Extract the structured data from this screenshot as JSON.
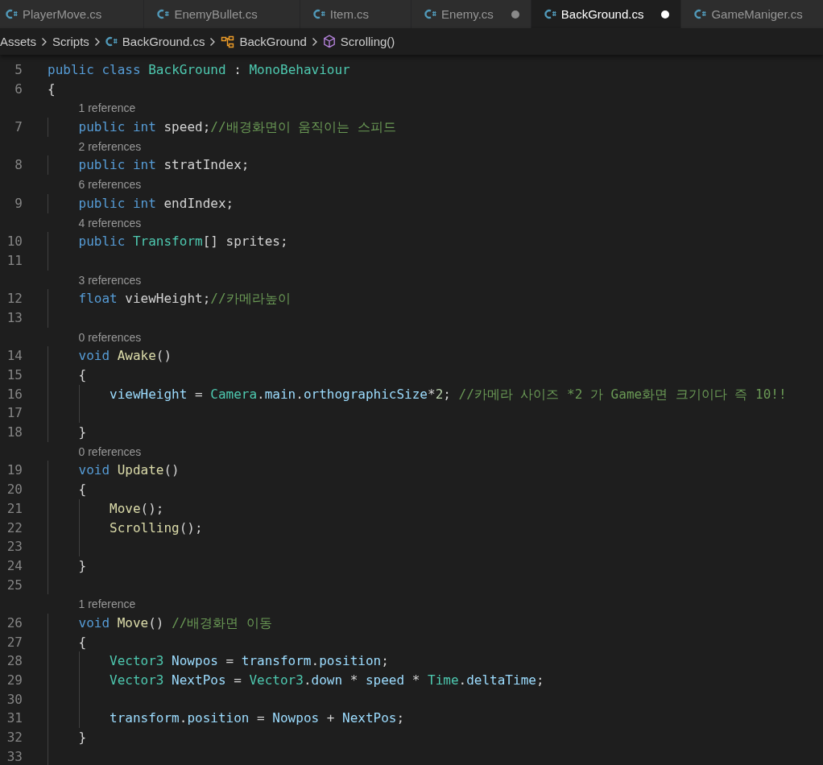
{
  "tabs": [
    {
      "label": "PlayerMove.cs",
      "selected": false,
      "modified": false
    },
    {
      "label": "EnemyBullet.cs",
      "selected": false,
      "modified": false
    },
    {
      "label": "Item.cs",
      "selected": false,
      "modified": false
    },
    {
      "label": "Enemy.cs",
      "selected": false,
      "modified": true
    },
    {
      "label": "BackGround.cs",
      "selected": true,
      "modified": true
    },
    {
      "label": "GameManiger.cs",
      "selected": false,
      "modified": false
    }
  ],
  "breadcrumb": [
    {
      "label": "Assets",
      "kind": "folder"
    },
    {
      "label": "Scripts",
      "kind": "folder"
    },
    {
      "label": "BackGround.cs",
      "kind": "file"
    },
    {
      "label": "BackGround",
      "kind": "class"
    },
    {
      "label": "Scrolling()",
      "kind": "method"
    }
  ],
  "lines": [
    {
      "number": "5",
      "tokens": [
        {
          "kind": "keyword",
          "text": "public class "
        },
        {
          "kind": "type",
          "text": "BackGround"
        },
        {
          "kind": "plain",
          "text": " : "
        },
        {
          "kind": "type",
          "text": "MonoBehaviour"
        }
      ]
    },
    {
      "number": "6",
      "tokens": [
        {
          "kind": "plain",
          "text": "{"
        }
      ],
      "children": [
        {
          "number": "7",
          "lens": "1 reference",
          "tokens": [
            {
              "kind": "keyword",
              "text": "public int "
            },
            {
              "kind": "plain",
              "text": "speed;"
            },
            {
              "kind": "comment",
              "text": "//배경화면이 움직이는 스피드"
            }
          ]
        },
        {
          "number": "8",
          "lens": "2 references",
          "tokens": [
            {
              "kind": "keyword",
              "text": "public int "
            },
            {
              "kind": "plain",
              "text": "stratIndex;"
            }
          ]
        },
        {
          "number": "9",
          "lens": "6 references",
          "tokens": [
            {
              "kind": "keyword",
              "text": "public int "
            },
            {
              "kind": "plain",
              "text": "endIndex;"
            }
          ]
        },
        {
          "number": "10",
          "lens": "4 references",
          "tokens": [
            {
              "kind": "keyword",
              "text": "public "
            },
            {
              "kind": "type",
              "text": "Transform"
            },
            {
              "kind": "plain",
              "text": "[] sprites;"
            }
          ]
        },
        {
          "number": "11"
        },
        {
          "number": "12",
          "lens": "3 references",
          "tokens": [
            {
              "kind": "keyword",
              "text": "float "
            },
            {
              "kind": "plain",
              "text": "viewHeight;"
            },
            {
              "kind": "comment",
              "text": "//카메라높이"
            }
          ]
        },
        {
          "number": "13"
        },
        {
          "number": "14",
          "lens": "0 references",
          "tokens": [
            {
              "kind": "keyword",
              "text": "void "
            },
            {
              "kind": "method",
              "text": "Awake"
            },
            {
              "kind": "plain",
              "text": "()"
            }
          ]
        },
        {
          "number": "15",
          "tokens": [
            {
              "kind": "plain",
              "text": "{"
            }
          ],
          "children": [
            {
              "number": "16",
              "tokens": [
                {
                  "kind": "ident",
                  "text": "viewHeight"
                },
                {
                  "kind": "plain",
                  "text": " = "
                },
                {
                  "kind": "type",
                  "text": "Camera"
                },
                {
                  "kind": "plain",
                  "text": "."
                },
                {
                  "kind": "ident",
                  "text": "main"
                },
                {
                  "kind": "plain",
                  "text": "."
                },
                {
                  "kind": "ident",
                  "text": "orthographicSize"
                },
                {
                  "kind": "plain",
                  "text": "*"
                },
                {
                  "kind": "number",
                  "text": "2"
                },
                {
                  "kind": "plain",
                  "text": "; "
                },
                {
                  "kind": "comment",
                  "text": "//카메라 사이즈 *2 가 Game화면 크기이다 즉 10!!"
                }
              ]
            },
            {
              "number": "17"
            }
          ]
        },
        {
          "number": "18",
          "tokens": [
            {
              "kind": "plain",
              "text": "}"
            }
          ]
        },
        {
          "number": "19",
          "lens": "0 references",
          "tokens": [
            {
              "kind": "keyword",
              "text": "void "
            },
            {
              "kind": "method",
              "text": "Update"
            },
            {
              "kind": "plain",
              "text": "()"
            }
          ]
        },
        {
          "number": "20",
          "tokens": [
            {
              "kind": "plain",
              "text": "{"
            }
          ],
          "children": [
            {
              "number": "21",
              "tokens": [
                {
                  "kind": "method",
                  "text": "Move"
                },
                {
                  "kind": "plain",
                  "text": "();"
                }
              ]
            },
            {
              "number": "22",
              "tokens": [
                {
                  "kind": "method",
                  "text": "Scrolling"
                },
                {
                  "kind": "plain",
                  "text": "();"
                }
              ]
            },
            {
              "number": "23"
            }
          ]
        },
        {
          "number": "24",
          "tokens": [
            {
              "kind": "plain",
              "text": "}"
            }
          ]
        },
        {
          "number": "25"
        },
        {
          "number": "26",
          "lens": "1 reference",
          "tokens": [
            {
              "kind": "keyword",
              "text": "void "
            },
            {
              "kind": "method",
              "text": "Move"
            },
            {
              "kind": "plain",
              "text": "() "
            },
            {
              "kind": "comment",
              "text": "//배경화면 이동"
            }
          ]
        },
        {
          "number": "27",
          "tokens": [
            {
              "kind": "plain",
              "text": "{"
            }
          ],
          "children": [
            {
              "number": "28",
              "tokens": [
                {
                  "kind": "type",
                  "text": "Vector3 "
                },
                {
                  "kind": "ident",
                  "text": "Nowpos"
                },
                {
                  "kind": "plain",
                  "text": " = "
                },
                {
                  "kind": "ident",
                  "text": "transform"
                },
                {
                  "kind": "plain",
                  "text": "."
                },
                {
                  "kind": "ident",
                  "text": "position"
                },
                {
                  "kind": "plain",
                  "text": ";"
                }
              ]
            },
            {
              "number": "29",
              "tokens": [
                {
                  "kind": "type",
                  "text": "Vector3 "
                },
                {
                  "kind": "ident",
                  "text": "NextPos"
                },
                {
                  "kind": "plain",
                  "text": " = "
                },
                {
                  "kind": "type",
                  "text": "Vector3"
                },
                {
                  "kind": "plain",
                  "text": "."
                },
                {
                  "kind": "ident",
                  "text": "down"
                },
                {
                  "kind": "plain",
                  "text": " * "
                },
                {
                  "kind": "ident",
                  "text": "speed"
                },
                {
                  "kind": "plain",
                  "text": " * "
                },
                {
                  "kind": "type",
                  "text": "Time"
                },
                {
                  "kind": "plain",
                  "text": "."
                },
                {
                  "kind": "ident",
                  "text": "deltaTime"
                },
                {
                  "kind": "plain",
                  "text": ";"
                }
              ]
            },
            {
              "number": "30"
            },
            {
              "number": "31",
              "tokens": [
                {
                  "kind": "ident",
                  "text": "transform"
                },
                {
                  "kind": "plain",
                  "text": "."
                },
                {
                  "kind": "ident",
                  "text": "position"
                },
                {
                  "kind": "plain",
                  "text": " = "
                },
                {
                  "kind": "ident",
                  "text": "Nowpos"
                },
                {
                  "kind": "plain",
                  "text": " + "
                },
                {
                  "kind": "ident",
                  "text": "NextPos"
                },
                {
                  "kind": "plain",
                  "text": ";"
                }
              ]
            }
          ]
        },
        {
          "number": "32",
          "tokens": [
            {
              "kind": "plain",
              "text": "}"
            }
          ]
        },
        {
          "number": "33"
        }
      ]
    }
  ]
}
